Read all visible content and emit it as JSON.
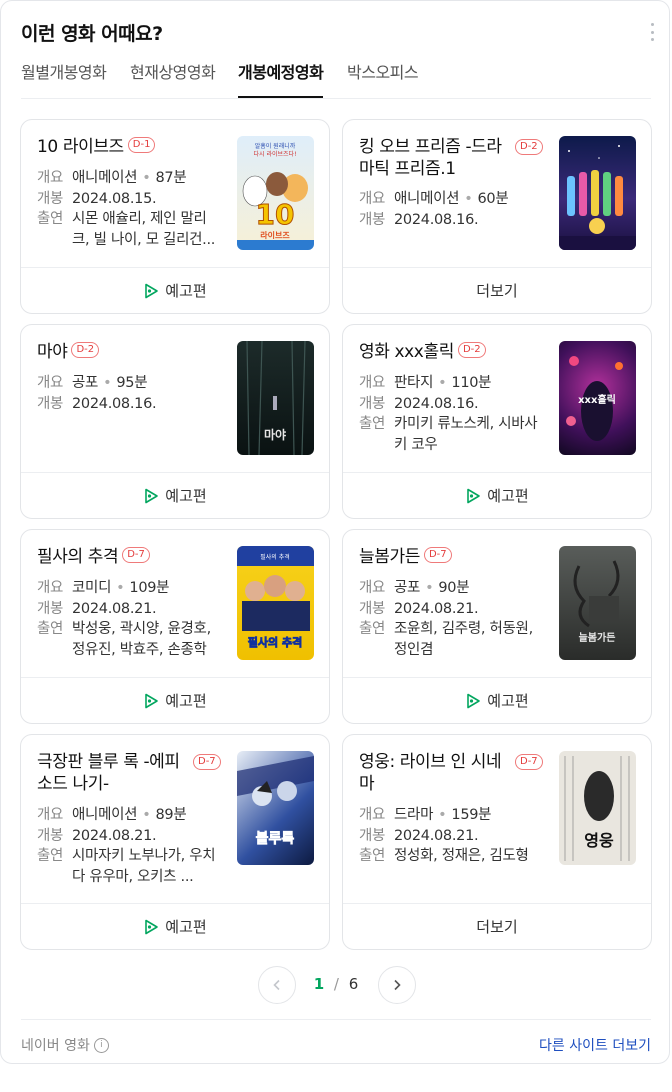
{
  "title": "이런 영화 어때요?",
  "tabs": [
    {
      "label": "월별개봉영화",
      "active": false
    },
    {
      "label": "현재상영영화",
      "active": false
    },
    {
      "label": "개봉예정영화",
      "active": true
    },
    {
      "label": "박스오피스",
      "active": false
    }
  ],
  "labels": {
    "summary": "개요",
    "release": "개봉",
    "cast": "출연",
    "trailer": "예고편",
    "more": "더보기"
  },
  "movies": [
    {
      "title": "10 라이브즈",
      "dday": "D-1",
      "genre": "애니메이션",
      "runtime": "87분",
      "release": "2024.08.15.",
      "cast": "시몬 애슐리, 제인 말리크, 빌 나이, 모 길리건...",
      "action": "예고편"
    },
    {
      "title": "킹 오브 프리즘 -드라마틱 프리즘.1",
      "dday": "D-2",
      "genre": "애니메이션",
      "runtime": "60분",
      "release": "2024.08.16.",
      "cast": "",
      "action": "더보기"
    },
    {
      "title": "마야",
      "dday": "D-2",
      "genre": "공포",
      "runtime": "95분",
      "release": "2024.08.16.",
      "cast": "",
      "action": "예고편"
    },
    {
      "title": "영화 xxx홀릭",
      "dday": "D-2",
      "genre": "판타지",
      "runtime": "110분",
      "release": "2024.08.16.",
      "cast": "카미키 류노스케, 시바사키 코우",
      "action": "예고편"
    },
    {
      "title": "필사의 추격",
      "dday": "D-7",
      "genre": "코미디",
      "runtime": "109분",
      "release": "2024.08.21.",
      "cast": "박성웅, 곽시양, 윤경호, 정유진, 박효주, 손종학",
      "action": "예고편"
    },
    {
      "title": "늘봄가든",
      "dday": "D-7",
      "genre": "공포",
      "runtime": "90분",
      "release": "2024.08.21.",
      "cast": "조윤희, 김주령, 허동원, 정인겸",
      "action": "예고편"
    },
    {
      "title": "극장판 블루 록 -에피소드 나기-",
      "dday": "D-7",
      "genre": "애니메이션",
      "runtime": "89분",
      "release": "2024.08.21.",
      "cast": "시마자키 노부나가, 우치다 유우마, 오키츠 ...",
      "action": "예고편"
    },
    {
      "title": "영웅: 라이브 인 시네마",
      "dday": "D-7",
      "genre": "드라마",
      "runtime": "159분",
      "release": "2024.08.21.",
      "cast": "정성화, 정재은, 김도형",
      "action": "더보기"
    }
  ],
  "posters": {
    "p0": {
      "line1": "알흠이 원래니까",
      "line2": "다시 라이브즈다!",
      "big": "10",
      "sub": "라이브즈"
    },
    "p2": {
      "text": "마야"
    },
    "p3": {
      "text": "xxx홀릭"
    },
    "p4": {
      "top": "필사의 추격",
      "title": "필사의 추격"
    },
    "p5": {
      "text": "늘봄가든"
    },
    "p6": {
      "text": "블루록"
    },
    "p7": {
      "text": "영웅"
    }
  },
  "pagination": {
    "current": "1",
    "separator": "/",
    "total": "6"
  },
  "footer": {
    "source": "네이버 영화",
    "info_icon": "i",
    "link": "다른 사이트 더보기"
  },
  "colors": {
    "dday_badge": "#e43d3d",
    "active_page": "#03a65f",
    "link": "#1f4fbf",
    "trailer_icon": "#03a65f"
  }
}
